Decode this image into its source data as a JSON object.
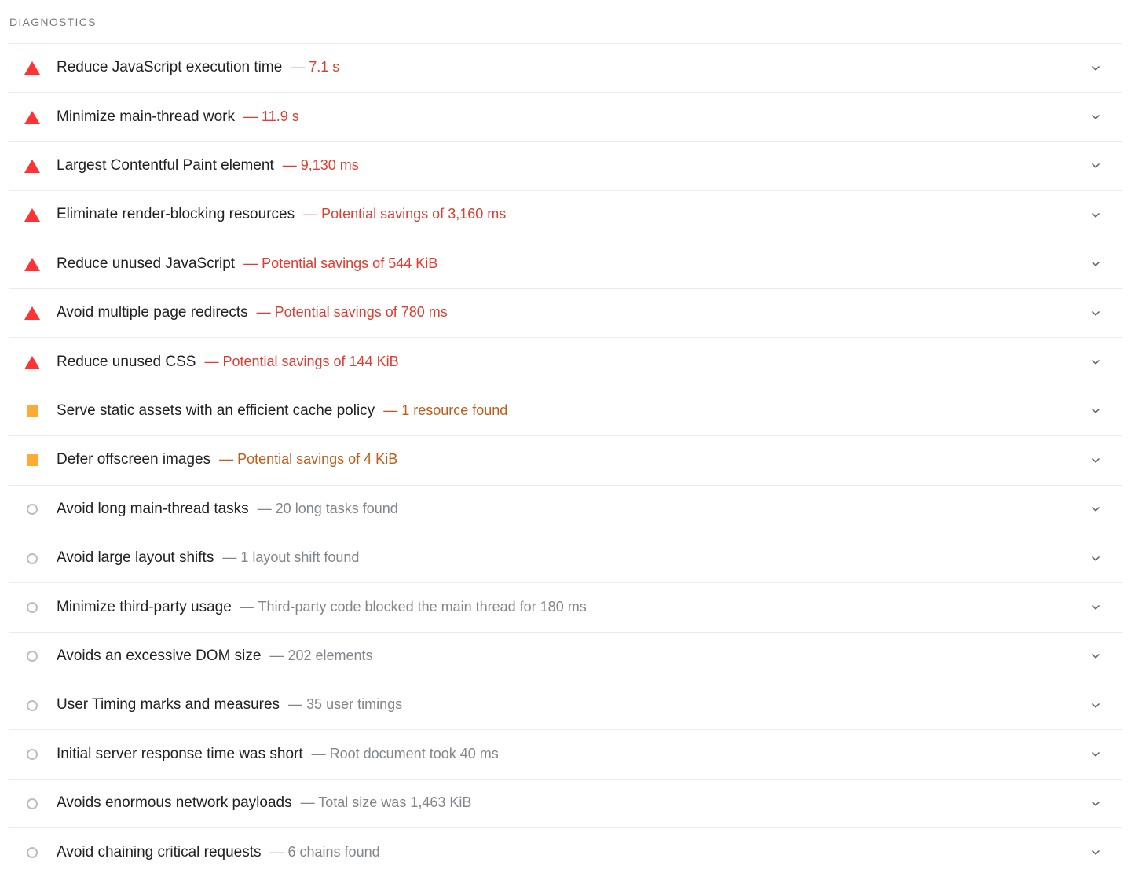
{
  "panel": {
    "header_title": "DIAGNOSTICS",
    "expand_icon": "chevron-down-icon"
  },
  "colors": {
    "fail_red": "#e13b2f",
    "average_orange": "#bf5c17",
    "info_gray": "#80868b",
    "title_text": "#202124",
    "header_text": "#78797c",
    "divider": "#ebebeb",
    "triangle_icon": "#f33",
    "square_icon": "#fa3",
    "circle_icon": "#bdbdbd"
  },
  "audits": [
    {
      "severity": "fail",
      "icon": "triangle-warning-icon",
      "title": "Reduce JavaScript execution time",
      "display_value": "— 7.1 s"
    },
    {
      "severity": "fail",
      "icon": "triangle-warning-icon",
      "title": "Minimize main-thread work",
      "display_value": "— 11.9 s"
    },
    {
      "severity": "fail",
      "icon": "triangle-warning-icon",
      "title": "Largest Contentful Paint element",
      "display_value": "— 9,130 ms"
    },
    {
      "severity": "fail",
      "icon": "triangle-warning-icon",
      "title": "Eliminate render-blocking resources",
      "display_value": "— Potential savings of 3,160 ms"
    },
    {
      "severity": "fail",
      "icon": "triangle-warning-icon",
      "title": "Reduce unused JavaScript",
      "display_value": "— Potential savings of 544 KiB"
    },
    {
      "severity": "fail",
      "icon": "triangle-warning-icon",
      "title": "Avoid multiple page redirects",
      "display_value": "— Potential savings of 780 ms"
    },
    {
      "severity": "fail",
      "icon": "triangle-warning-icon",
      "title": "Reduce unused CSS",
      "display_value": "— Potential savings of 144 KiB"
    },
    {
      "severity": "average",
      "icon": "square-warning-icon",
      "title": "Serve static assets with an efficient cache policy",
      "display_value": "— 1 resource found"
    },
    {
      "severity": "average",
      "icon": "square-warning-icon",
      "title": "Defer offscreen images",
      "display_value": "— Potential savings of 4 KiB"
    },
    {
      "severity": "info",
      "icon": "circle-info-icon",
      "title": "Avoid long main-thread tasks",
      "display_value": "— 20 long tasks found"
    },
    {
      "severity": "info",
      "icon": "circle-info-icon",
      "title": "Avoid large layout shifts",
      "display_value": "— 1 layout shift found"
    },
    {
      "severity": "info",
      "icon": "circle-info-icon",
      "title": "Minimize third-party usage",
      "display_value": "— Third-party code blocked the main thread for 180 ms"
    },
    {
      "severity": "info",
      "icon": "circle-info-icon",
      "title": "Avoids an excessive DOM size",
      "display_value": "— 202 elements"
    },
    {
      "severity": "info",
      "icon": "circle-info-icon",
      "title": "User Timing marks and measures",
      "display_value": "— 35 user timings"
    },
    {
      "severity": "info",
      "icon": "circle-info-icon",
      "title": "Initial server response time was short",
      "display_value": "— Root document took 40 ms"
    },
    {
      "severity": "info",
      "icon": "circle-info-icon",
      "title": "Avoids enormous network payloads",
      "display_value": "— Total size was 1,463 KiB"
    },
    {
      "severity": "info",
      "icon": "circle-info-icon",
      "title": "Avoid chaining critical requests",
      "display_value": "— 6 chains found"
    }
  ]
}
